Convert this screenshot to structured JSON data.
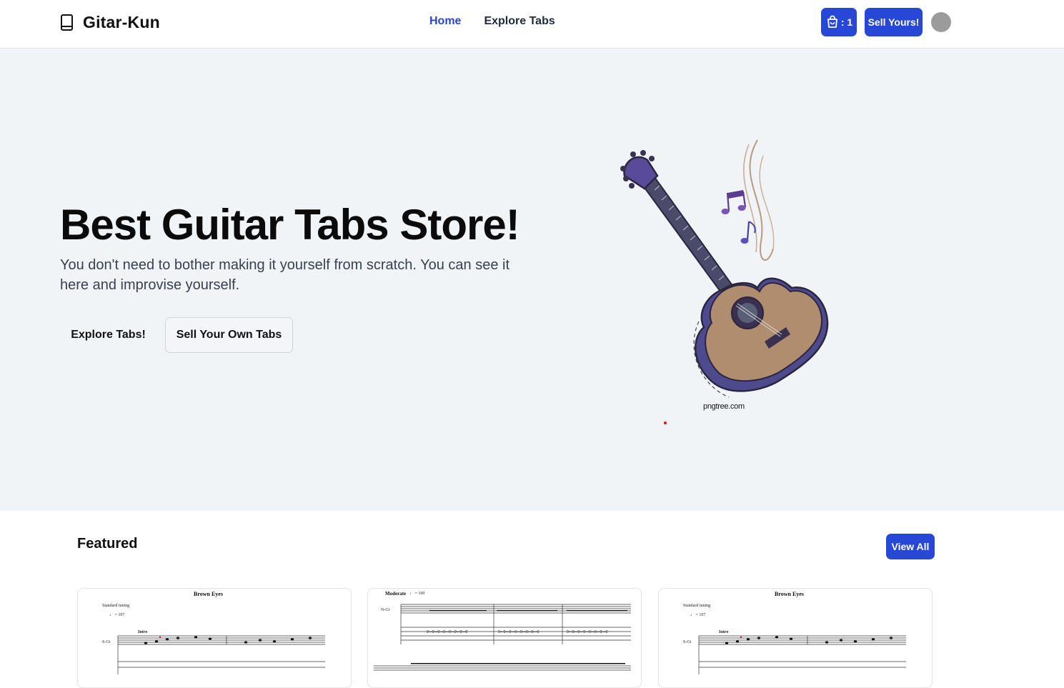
{
  "header": {
    "brand": "Gitar-Kun",
    "nav": [
      {
        "label": "Home",
        "active": true
      },
      {
        "label": "Explore Tabs",
        "active": false
      }
    ],
    "cart_count": ": 1",
    "sell_label": "Sell Yours!"
  },
  "hero": {
    "title": "Best Guitar Tabs Store!",
    "subtitle": "You don't need to bother making it yourself from scratch. You can see it here and improvise yourself.",
    "explore_label": "Explore Tabs!",
    "sell_own_label": "Sell Your Own Tabs",
    "image_credit": "pngtree.com"
  },
  "featured": {
    "title": "Featured",
    "view_all_label": "View All",
    "cards": [
      {
        "sheet_title": "Brown Eyes",
        "tempo": "♩ = 107",
        "tuning": "Standard tuning",
        "part": "S-Gt",
        "section": "Intro"
      },
      {
        "sheet_title": "Moderate",
        "tempo": "♩ = 100",
        "part": "N-Gt"
      },
      {
        "sheet_title": "Brown Eyes",
        "tempo": "♩ = 107",
        "tuning": "Standard tuning",
        "part": "S-Gt",
        "section": "Intro"
      }
    ]
  },
  "colors": {
    "accent": "#2748d6",
    "hero_bg": "#f1f4f7",
    "nav_active": "#2a45c9"
  }
}
